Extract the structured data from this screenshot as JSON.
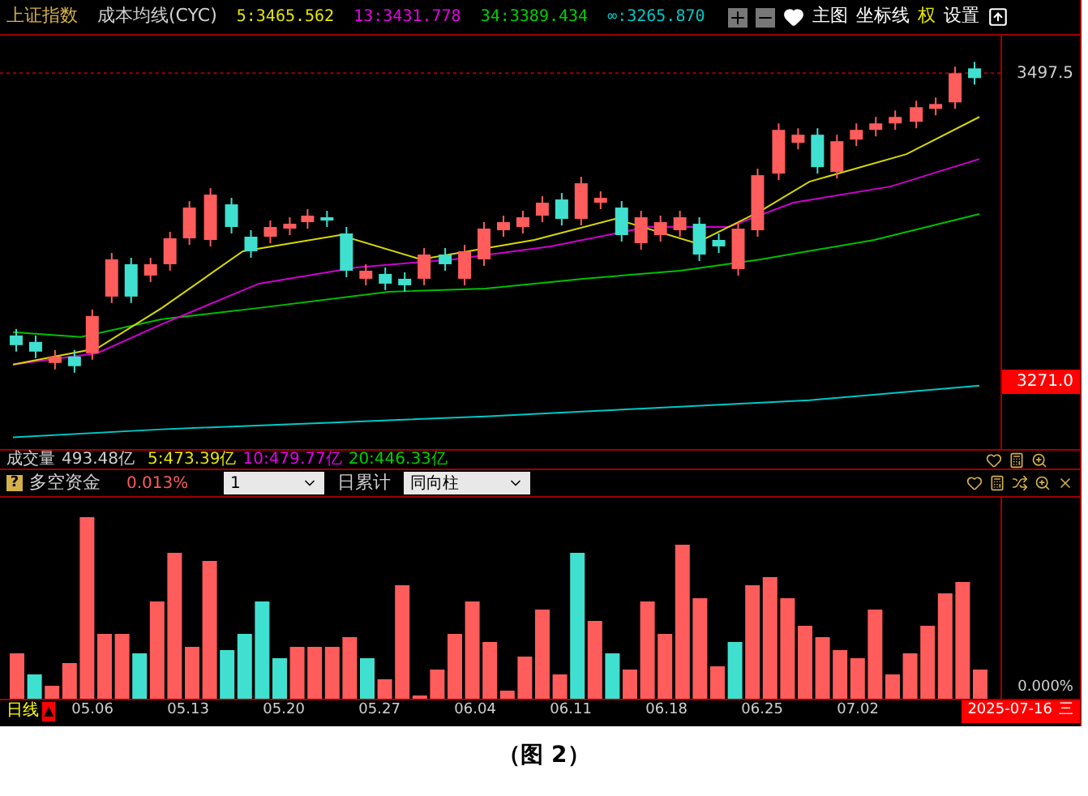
{
  "header": {
    "title": "上证指数",
    "indicator": "成本均线(CYC)",
    "averages": [
      {
        "text": "5:3465.562",
        "color": "#e6e600"
      },
      {
        "text": "13:3431.778",
        "color": "#e600e6"
      },
      {
        "text": "34:3389.434",
        "color": "#00d000"
      },
      {
        "text": "∞:3265.870",
        "color": "#00c8c8"
      }
    ],
    "menu": [
      {
        "text": "主图",
        "color": "#ffffff"
      },
      {
        "text": "坐标线",
        "color": "#ffffff"
      },
      {
        "text": "权",
        "color": "#e6e600"
      },
      {
        "text": "设置",
        "color": "#ffffff"
      }
    ]
  },
  "price_axis": {
    "high": "3497.5",
    "low": "3271.0"
  },
  "volume": {
    "label": "成交量",
    "value": "493.48亿",
    "averages": [
      {
        "text": "5:473.39亿",
        "color": "#e6e600"
      },
      {
        "text": "10:479.77亿",
        "color": "#e600e6"
      },
      {
        "text": "20:446.33亿",
        "color": "#00d000"
      }
    ]
  },
  "indicator_panel": {
    "help": "?",
    "name": "多空资金",
    "value": "0.013%",
    "period_select": "1",
    "mode_label": "日累计",
    "mode_select": "同向柱",
    "axis_label": "0.000%"
  },
  "time_axis": {
    "period": "日线",
    "marker": "▲",
    "dates": [
      "05.06",
      "05.13",
      "05.20",
      "05.27",
      "06.04",
      "06.11",
      "06.18",
      "06.25",
      "07.02"
    ],
    "current_date": "2025-07-16",
    "menu": "三"
  },
  "caption": "（图 2）"
}
